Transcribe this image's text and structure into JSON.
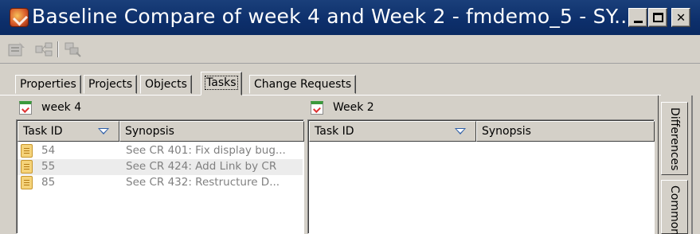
{
  "window": {
    "title": "Baseline Compare of week 4 and Week 2 - fmdemo_5 - SY...",
    "minimize_icon": "minimize-icon",
    "maximize_icon": "maximize-icon",
    "close_icon": "close-icon"
  },
  "toolbar": {
    "icons": [
      "properties-icon",
      "compare-icon",
      "show-differences-icon"
    ]
  },
  "tabs": [
    {
      "label": "Properties",
      "active": false
    },
    {
      "label": "Projects",
      "active": false
    },
    {
      "label": "Objects",
      "active": false
    },
    {
      "label": "Tasks",
      "active": true
    },
    {
      "label": "Change Requests",
      "active": false
    }
  ],
  "left_pane": {
    "title": "week 4",
    "columns": [
      "Task ID",
      "Synopsis"
    ],
    "rows": [
      {
        "id": "54",
        "synopsis": "See CR 401: Fix display bug..."
      },
      {
        "id": "55",
        "synopsis": "See CR 424: Add Link by CR"
      },
      {
        "id": "85",
        "synopsis": "See CR 432: Restructure D..."
      }
    ]
  },
  "right_pane": {
    "title": "Week 2",
    "columns": [
      "Task ID",
      "Synopsis"
    ],
    "rows": []
  },
  "side_tabs": [
    "Differences",
    "Common"
  ],
  "colors": {
    "titlebar": "#0d2f6b",
    "chrome": "#d4d0c8",
    "sort_indicator": "#2e5fa8",
    "row_text": "#808080"
  }
}
